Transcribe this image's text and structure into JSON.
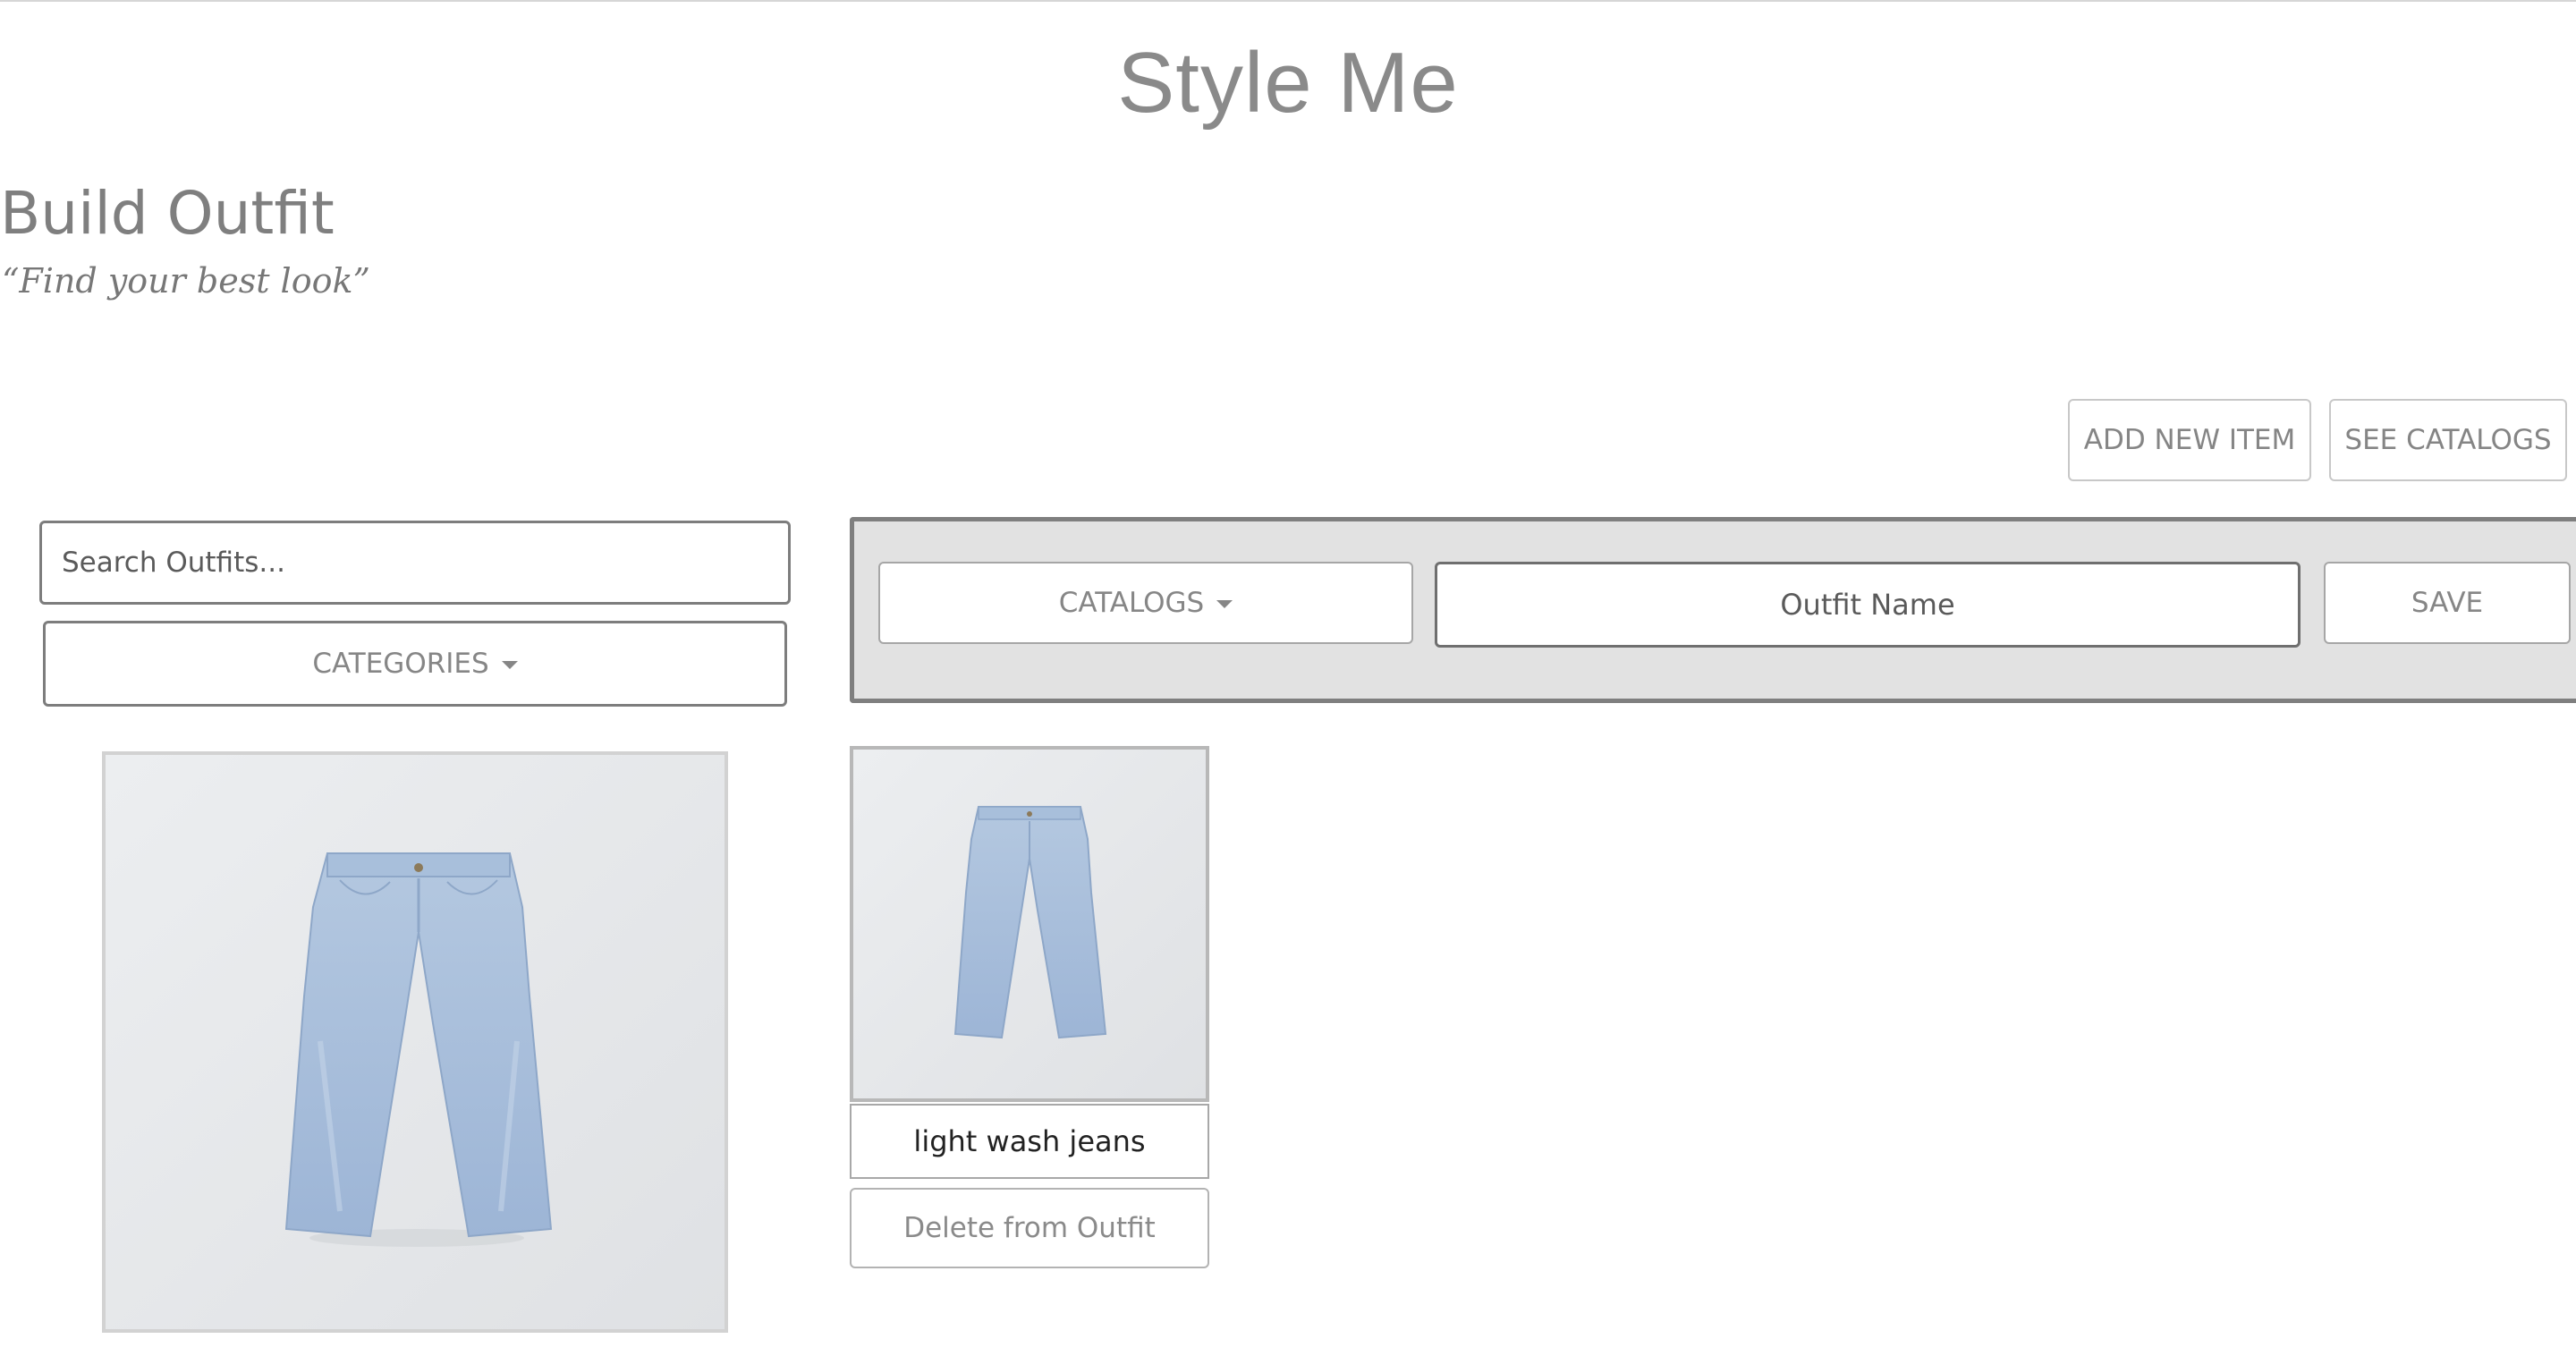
{
  "header": {
    "app_title": "Style Me"
  },
  "page": {
    "title": "Build Outfit",
    "tagline": "“Find your best look”"
  },
  "actions": {
    "add_new_item": "ADD NEW ITEM",
    "see_catalogs": "SEE CATALOGS"
  },
  "sidebar": {
    "search_placeholder": "Search Outfits...",
    "categories_label": "CATEGORIES"
  },
  "builder": {
    "catalogs_label": "CATALOGS",
    "outfit_name_placeholder": "Outfit Name",
    "save_label": "SAVE"
  },
  "catalog_items": [
    {
      "image": "light-wash-jeans-image"
    }
  ],
  "outfit_items": [
    {
      "image": "light-wash-jeans-image",
      "name": "light wash jeans",
      "delete_label": "Delete from Outfit"
    }
  ],
  "colors": {
    "panel_bg": "#e2e2e2",
    "panel_border": "#7f7f7f",
    "text_muted": "#868686",
    "denim": "#a9c1dd"
  }
}
